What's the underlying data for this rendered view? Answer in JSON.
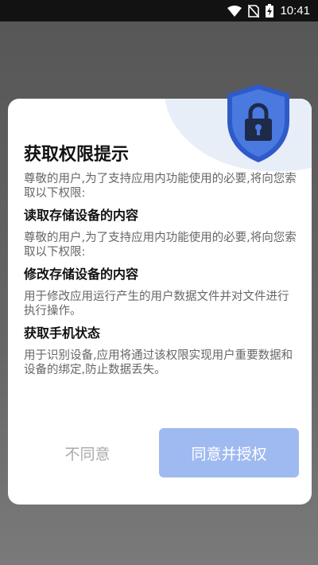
{
  "status_bar": {
    "time": "10:41"
  },
  "dialog": {
    "title": "获取权限提示",
    "intro": "尊敬的用户,为了支持应用内功能使用的必要,将向您索取以下权限:",
    "permissions": [
      {
        "title": "读取存储设备的内容",
        "desc": "尊敬的用户,为了支持应用内功能使用的必要,将向您索取以下权限:"
      },
      {
        "title": "修改存储设备的内容",
        "desc": "用于修改应用运行产生的用户数据文件并对文件进行执行操作。"
      },
      {
        "title": "获取手机状态",
        "desc": "用于识别设备,应用将通过该权限实现用户重要数据和设备的绑定,防止数据丢失。"
      }
    ],
    "cancel_label": "不同意",
    "agree_label": "同意并授权"
  },
  "icons": [
    "wifi-icon",
    "no-sim-icon",
    "battery-charging-icon",
    "lock-shield-icon"
  ],
  "colors": {
    "accent": "#9fbaf0",
    "shield": "#3f6ad8",
    "overlay": "#5a5a5a"
  }
}
